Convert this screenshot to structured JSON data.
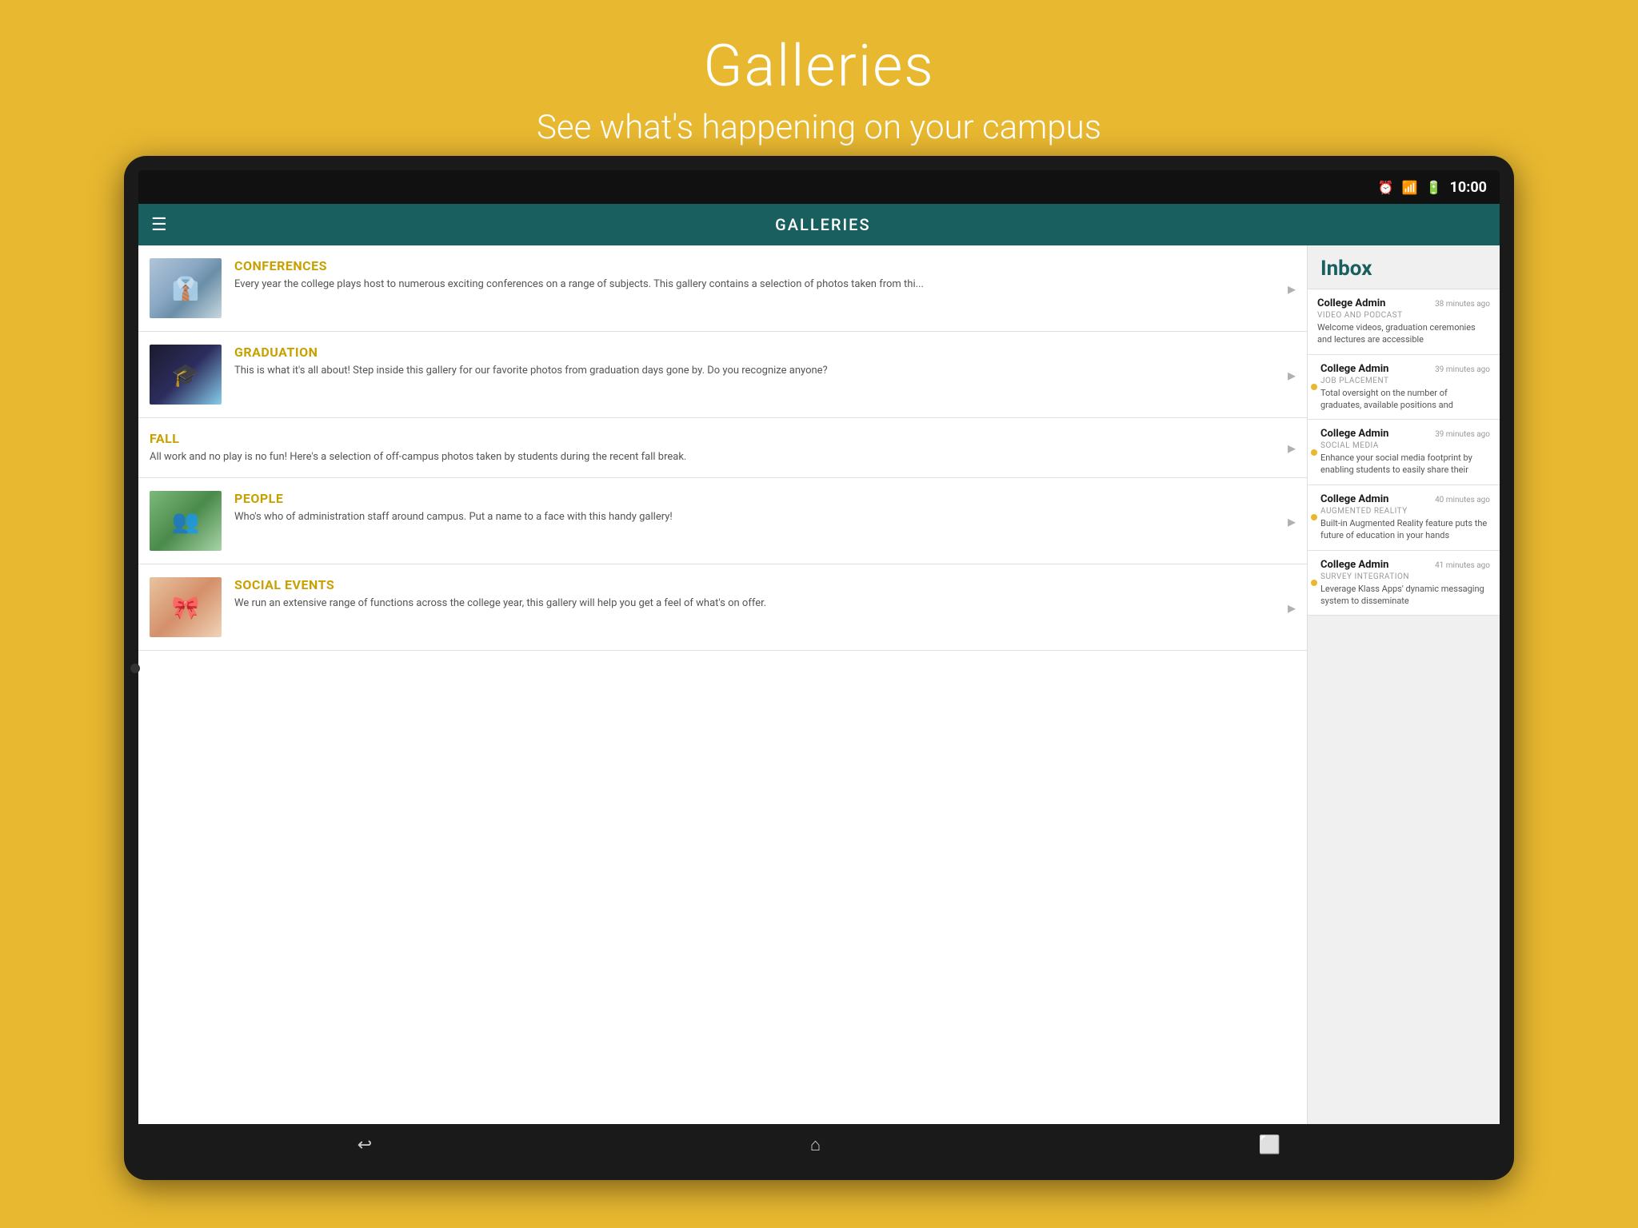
{
  "page": {
    "title": "Galleries",
    "subtitle": "See what's happening on your campus",
    "background_color": "#E8B830"
  },
  "status_bar": {
    "time": "10:00",
    "icons": [
      "⏰",
      "📶",
      "🔋"
    ]
  },
  "app_bar": {
    "title": "GALLERIES",
    "menu_icon": "☰"
  },
  "gallery_items": [
    {
      "id": "conferences",
      "name": "CONFERENCES",
      "description": "Every year the college plays host to numerous exciting conferences on a range of subjects.  This gallery contains a selection of photos taken from thi...",
      "has_image": true,
      "image_class": "img-conferences"
    },
    {
      "id": "graduation",
      "name": "GRADUATION",
      "description": "This is what it's all about!  Step inside this gallery for our favorite photos from graduation days gone by.  Do you recognize anyone?",
      "has_image": true,
      "image_class": "img-graduation"
    },
    {
      "id": "fall",
      "name": "FALL",
      "description": "All work and no play is no fun!  Here's a selection of off-campus photos taken by students during the recent fall break.",
      "has_image": false,
      "image_class": ""
    },
    {
      "id": "people",
      "name": "PEOPLE",
      "description": "Who's who of administration staff around campus.  Put a name to a face with this handy gallery!",
      "has_image": true,
      "image_class": "img-people"
    },
    {
      "id": "social-events",
      "name": "SOCIAL EVENTS",
      "description": "We run an extensive range of functions across the college year, this gallery will help you get a feel of what's on offer.",
      "has_image": true,
      "image_class": "img-social"
    }
  ],
  "inbox": {
    "title": "Inbox",
    "items": [
      {
        "sender": "College Admin",
        "time": "38 minutes ago",
        "category": "VIDEO AND PODCAST",
        "preview": "Welcome videos, graduation ceremonies and lectures are accessible",
        "unread": false
      },
      {
        "sender": "College Admin",
        "time": "39 minutes ago",
        "category": "JOB PLACEMENT",
        "preview": "Total oversight on the number of graduates, available positions and",
        "unread": true
      },
      {
        "sender": "College Admin",
        "time": "39 minutes ago",
        "category": "SOCIAL MEDIA",
        "preview": "Enhance your social media footprint by enabling students to easily share their",
        "unread": true
      },
      {
        "sender": "College Admin",
        "time": "40 minutes ago",
        "category": "AUGMENTED REALITY",
        "preview": "Built-in Augmented Reality feature puts the future of education in your hands",
        "unread": true
      },
      {
        "sender": "College Admin",
        "time": "41 minutes ago",
        "category": "SURVEY INTEGRATION",
        "preview": "Leverage Klass Apps' dynamic messaging system to disseminate",
        "unread": true
      }
    ]
  },
  "bottom_nav": {
    "back_icon": "↩",
    "home_icon": "⌂",
    "recents_icon": "⬜"
  }
}
